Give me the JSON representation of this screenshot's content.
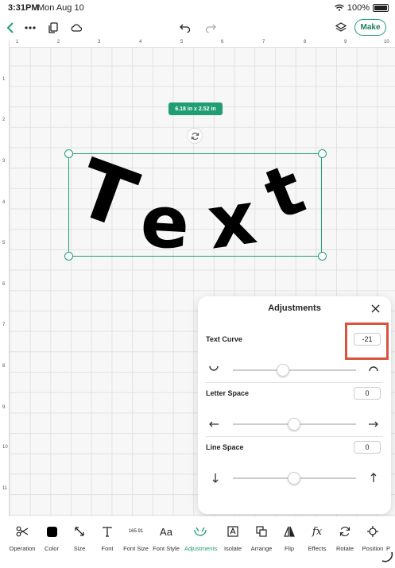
{
  "status_bar": {
    "time": "3:31PM",
    "date": "Mon Aug 10",
    "battery": "100%"
  },
  "top_bar": {
    "make_label": "Make"
  },
  "ruler_top": [
    "1",
    "2",
    "3",
    "4",
    "5",
    "6",
    "7",
    "8",
    "9",
    "10"
  ],
  "ruler_left": [
    "1",
    "2",
    "3",
    "4",
    "5",
    "6",
    "7",
    "8",
    "9",
    "10",
    "11"
  ],
  "canvas": {
    "dimensions": "6.18 in x 2.52 in",
    "letters": [
      "T",
      "e",
      "x",
      "t"
    ]
  },
  "adjustments": {
    "title": "Adjustments",
    "text_curve": {
      "label": "Text Curve",
      "value": "-21"
    },
    "letter_space": {
      "label": "Letter Space",
      "value": "0"
    },
    "line_space": {
      "label": "Line Space",
      "value": "0"
    }
  },
  "toolbar": {
    "items": [
      {
        "label": "Operation",
        "icon": "scissors-icon"
      },
      {
        "label": "Color",
        "icon": "color-swatch-icon"
      },
      {
        "label": "Size",
        "icon": "resize-icon"
      },
      {
        "label": "Font",
        "icon": "font-icon"
      },
      {
        "label": "Font Size",
        "icon": "font-size-icon",
        "value": "165.91"
      },
      {
        "label": "Font Style",
        "icon": "font-style-icon",
        "glyph": "Aa"
      },
      {
        "label": "Adjustments",
        "icon": "adjustments-icon"
      },
      {
        "label": "Isolate",
        "icon": "isolate-icon"
      },
      {
        "label": "Arrange",
        "icon": "arrange-icon"
      },
      {
        "label": "Flip",
        "icon": "flip-icon"
      },
      {
        "label": "Effects",
        "icon": "effects-icon",
        "glyph": "fx"
      },
      {
        "label": "Rotate",
        "icon": "rotate-icon"
      },
      {
        "label": "Position",
        "icon": "position-icon"
      },
      {
        "label": "P",
        "icon": "more-icon"
      }
    ]
  },
  "colors": {
    "accent": "#1f9e74",
    "highlight": "#d9533f"
  }
}
